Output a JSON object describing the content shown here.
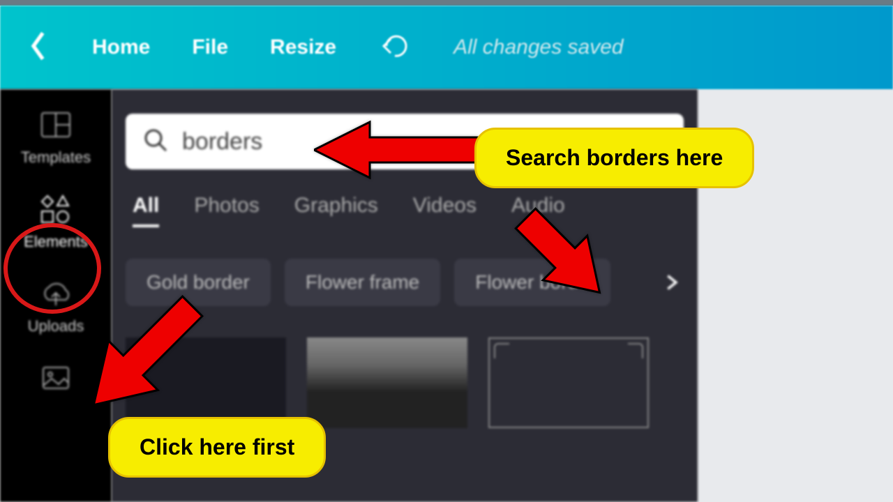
{
  "header": {
    "home": "Home",
    "file": "File",
    "resize": "Resize",
    "saved": "All changes saved"
  },
  "sidebar": {
    "templates": "Templates",
    "elements": "Elements",
    "uploads": "Uploads"
  },
  "search": {
    "value": "borders"
  },
  "tabs": {
    "all": "All",
    "photos": "Photos",
    "graphics": "Graphics",
    "videos": "Videos",
    "audio": "Audio"
  },
  "chips": {
    "c1": "Gold border",
    "c2": "Flower frame",
    "c3": "Flower borde"
  },
  "annotations": {
    "search_hint": "Search borders here",
    "click_hint": "Click here first"
  }
}
